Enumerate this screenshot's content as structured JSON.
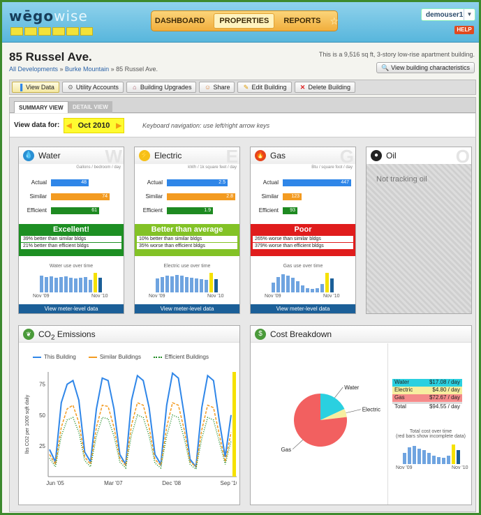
{
  "header": {
    "logo_left": "wēgo",
    "logo_right": "wise",
    "nav": [
      "DASHBOARD",
      "PROPERTIES",
      "REPORTS"
    ],
    "nav_active": "PROPERTIES",
    "user": "demouser1",
    "help": "HELP"
  },
  "building": {
    "title": "85 Russel Ave.",
    "breadcrumb": [
      "All Developments",
      "Burke Mountain",
      "85 Russel Ave."
    ],
    "description": "This is a 9,516 sq ft, 3-story low-rise apartment building.",
    "view_characteristics": "View building characteristics"
  },
  "toolbar": [
    "View Data",
    "Utility Accounts",
    "Building Upgrades",
    "Share",
    "Edit Building",
    "Delete Building"
  ],
  "tabs": {
    "summary": "SUMMARY VIEW",
    "detail": "DETAIL VIEW"
  },
  "view_data": {
    "label": "View data for:",
    "period": "Oct 2010",
    "keyboard_hint": "Keyboard navigation: use left/right arrow keys"
  },
  "colors": {
    "actual": "#2f86e8",
    "similar": "#f39b21",
    "efficient": "#1e8a21",
    "excellent": "#1d8f23",
    "better": "#83c226",
    "poor": "#e01c1c",
    "meter": "#1b5f98"
  },
  "cards": [
    {
      "name": "Water",
      "letter": "W",
      "icon": "water-drop-icon",
      "unit": "Gallons / bedroom / day",
      "actual": "48",
      "similar": "74",
      "efficient": "61",
      "verdict": "Excellent!",
      "line1": "39% better than similar bldgs",
      "line2": "21% better than efficient bldgs",
      "caption": "Water use over time",
      "start": "Nov '09",
      "end": "Nov '10",
      "meter": "View meter-level data"
    },
    {
      "name": "Electric",
      "letter": "E",
      "icon": "lightning-icon",
      "unit": "kWh / 1k square feet / day",
      "actual": "2.5",
      "similar": "2.8",
      "efficient": "1.9",
      "verdict": "Better than average",
      "line1": "10% better than similar bldgs",
      "line2": "35% worse than efficient bldgs",
      "caption": "Electric use over time",
      "start": "Nov '09",
      "end": "Nov '10",
      "meter": "View meter-level data"
    },
    {
      "name": "Gas",
      "letter": "G",
      "icon": "flame-icon",
      "unit": "Btu / square foot / day",
      "actual": "447",
      "similar": "123",
      "efficient": "93",
      "verdict": "Poor",
      "line1": "265% worse than similar bldgs",
      "line2": "379% worse than efficient bldgs",
      "caption": "Gas use over time",
      "start": "Nov '09",
      "end": "Nov '10",
      "meter": "View meter-level data"
    },
    {
      "name": "Oil",
      "letter": "O",
      "icon": "oil-drop-icon",
      "not_tracking": "Not tracking oil"
    }
  ],
  "bar_labels": [
    "Actual",
    "Similar",
    "Efficient"
  ],
  "co2": {
    "title_pre": "CO",
    "title_sub": "2",
    "title_post": " Emissions",
    "ylabel": "lbs CO2 per 1000 sqft daily"
  },
  "cost": {
    "title": "Cost Breakdown",
    "pie_labels": [
      "Water",
      "Electric",
      "Gas"
    ],
    "rows": [
      {
        "k": "Water",
        "v": "$17.08 / day"
      },
      {
        "k": "Electric",
        "v": "$4.80 / day"
      },
      {
        "k": "Gas",
        "v": "$72.67 / day"
      },
      {
        "k": "Total",
        "v": "$94.55 / day"
      }
    ],
    "cap1": "Total cost over time",
    "cap2": "(red bars show incomplete data)",
    "start": "Nov '09",
    "end": "Nov '10"
  },
  "chart_data": [
    {
      "type": "bar",
      "title": "Water",
      "categories": [
        "Actual",
        "Similar",
        "Efficient"
      ],
      "values": [
        48,
        74,
        61
      ]
    },
    {
      "type": "bar",
      "title": "Electric",
      "categories": [
        "Actual",
        "Similar",
        "Efficient"
      ],
      "values": [
        2.5,
        2.8,
        1.9
      ]
    },
    {
      "type": "bar",
      "title": "Gas",
      "categories": [
        "Actual",
        "Similar",
        "Efficient"
      ],
      "values": [
        447,
        123,
        93
      ]
    },
    {
      "type": "line",
      "title": "CO2 Emissions",
      "ylabel": "lbs CO2 per 1000 sqft daily",
      "ylim": [
        0,
        85
      ],
      "x_ticks": [
        "Jun '05",
        "Mar '07",
        "Dec '08",
        "Sep '10"
      ],
      "y_ticks": [
        25,
        50,
        75
      ],
      "series": [
        {
          "name": "This Building",
          "values": [
            22,
            12,
            60,
            75,
            78,
            62,
            20,
            12,
            55,
            80,
            78,
            55,
            18,
            10,
            62,
            82,
            78,
            56,
            18,
            10,
            58,
            84,
            80,
            50,
            14,
            8,
            56,
            82,
            78,
            45,
            16,
            50
          ]
        },
        {
          "name": "Similar Buildings",
          "values": [
            18,
            10,
            40,
            55,
            58,
            44,
            16,
            10,
            40,
            58,
            57,
            40,
            15,
            9,
            42,
            60,
            58,
            40,
            14,
            9,
            40,
            60,
            58,
            38,
            12,
            8,
            38,
            58,
            56,
            34,
            12,
            36
          ]
        },
        {
          "name": "Efficient Buildings",
          "values": [
            15,
            8,
            33,
            46,
            48,
            36,
            13,
            8,
            33,
            48,
            47,
            33,
            12,
            7,
            34,
            50,
            48,
            33,
            11,
            7,
            33,
            50,
            48,
            31,
            10,
            6,
            31,
            48,
            46,
            28,
            10,
            29
          ]
        }
      ]
    },
    {
      "type": "pie",
      "title": "Cost Breakdown",
      "categories": [
        "Water",
        "Electric",
        "Gas"
      ],
      "values": [
        17.08,
        4.8,
        72.67
      ]
    }
  ]
}
